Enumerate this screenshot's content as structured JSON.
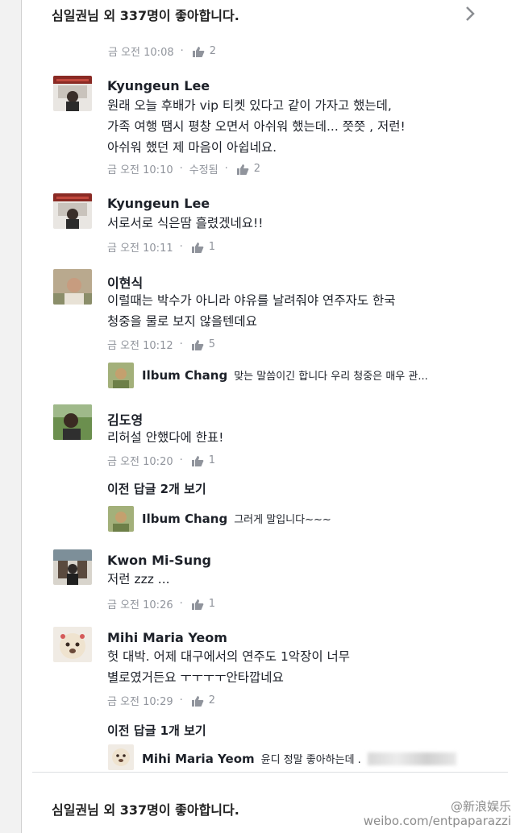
{
  "top_likes": "심일권님 외 337명이 좋아합니다.",
  "bottom_likes": "심일권님 외 337명이 좋아합니다.",
  "header_meta": {
    "time": "금 오전 10:08",
    "likes": "2"
  },
  "comments": [
    {
      "author": "Kyungeun Lee",
      "lines": [
        "원래 오늘 후배가 vip 티켓 있다고 같이 가자고 했는데,",
        "가족 여행 땜시 평창 오면서 아쉬워 했는데... 쯧쯧 , 저런!",
        "아쉬워 했던 제 마음이 아쉽네요."
      ],
      "time": "금 오전 10:10",
      "edited": "수정됨",
      "likes": "2"
    },
    {
      "author": "Kyungeun Lee",
      "lines": [
        "서로서로 식은땀 흘렸겠네요!!"
      ],
      "time": "금 오전 10:11",
      "likes": "1"
    },
    {
      "author": "이현식",
      "lines": [
        "이럴때는 박수가 아니라 야유를 날려줘야 연주자도 한국",
        "청중을 물로 보지 않을텐데요"
      ],
      "time": "금 오전 10:12",
      "likes": "5",
      "reply": {
        "author": "Ilbum Chang",
        "text": "맞는 말씀이긴 합니다 우리 청중은 매우 관..."
      }
    },
    {
      "author": "김도영",
      "lines": [
        "리허설 안했다에 한표!"
      ],
      "time": "금 오전 10:20",
      "likes": "1",
      "more_replies": "이전 답글 2개 보기",
      "reply": {
        "author": "Ilbum Chang",
        "text": "그러게 말입니다~~~"
      }
    },
    {
      "author": "Kwon Mi-Sung",
      "lines": [
        "저런 zzz ..."
      ],
      "time": "금 오전 10:26",
      "likes": "1"
    },
    {
      "author": "Mihi Maria Yeom",
      "lines": [
        "헛 대박. 어제 대구에서의 연주도 1악장이 너무",
        "별로였거든요 ㅜㅜㅜㅜ안타깝네요"
      ],
      "time": "금 오전 10:29",
      "likes": "2",
      "more_replies": "이전 답글 1개 보기",
      "reply": {
        "author": "Mihi Maria Yeom",
        "text": "윤디 정말 좋아하는데 ."
      }
    }
  ],
  "watermark": {
    "line1": "@新浪娱乐",
    "line2": "weibo.com/entpaparazzi"
  },
  "icons": {
    "like": "thumbs-up-icon",
    "chevron": "chevron-right-icon"
  },
  "colors": {
    "meta": "#90949c",
    "text": "#1d2129"
  }
}
